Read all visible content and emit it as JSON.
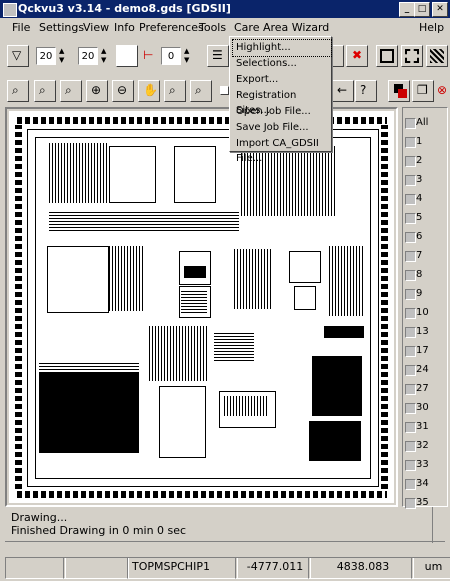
{
  "window": {
    "title": "Qckvu3 v3.14 - demo8.gds [GDSII]"
  },
  "menu": [
    "File",
    "Settings",
    "View",
    "Info",
    "Preferences",
    "Tools",
    "Care Area Wizard",
    "Help"
  ],
  "dropdown": [
    "Highlight...",
    "Selections...",
    "Export...",
    "Registration Sites...",
    "Open Job File...",
    "Save Job File...",
    "Import CA_GDSII File..."
  ],
  "toolbar": {
    "spin1": "20",
    "spin2": "20",
    "spin3": "0"
  },
  "layers": [
    "All",
    "1",
    "2",
    "3",
    "4",
    "5",
    "6",
    "7",
    "8",
    "9",
    "10",
    "13",
    "17",
    "24",
    "27",
    "30",
    "31",
    "32",
    "33",
    "34",
    "35"
  ],
  "messages": [
    "Drawing...",
    "Finished Drawing in 0 min 0 sec"
  ],
  "status": {
    "cell": "TOPMSPCHIP1",
    "x": "-4777.011",
    "y": "4838.083",
    "unit": "um"
  }
}
